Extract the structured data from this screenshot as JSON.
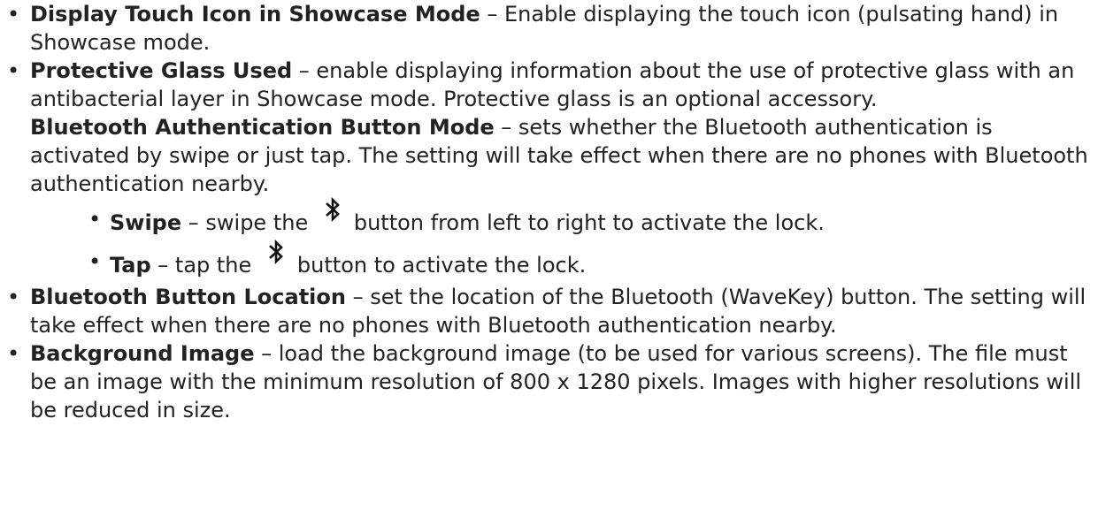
{
  "bullet_glyph": "•",
  "items": [
    {
      "term": "Display Touch Icon in Showcase Mode",
      "text": " – Enable displaying the touch icon (pulsating hand) in Showcase mode."
    },
    {
      "term": "Protective Glass Used",
      "text": " – enable displaying information about the use of protective glass with an antibacterial layer in Showcase mode. Protective glass is an optional accessory.",
      "continuation_term": "Bluetooth Authentication Button Mode",
      "continuation_text": " – sets whether the Bluetooth authentication is activated by swipe or just tap.  The setting will take effect when there are no phones with Bluetooth authentication nearby.",
      "subitems": [
        {
          "term": "Swipe",
          "before_icon": " – swipe the ",
          "icon": "bluetooth-icon",
          "after_icon": "button from left to right to activate the lock."
        },
        {
          "term": "Tap",
          "before_icon": " – tap the ",
          "icon": "bluetooth-icon",
          "after_icon": "button to activate the lock."
        }
      ]
    },
    {
      "term": "Bluetooth Button Location",
      "text": " – set the location of the Bluetooth (WaveKey) button. The setting will take effect when there are no phones with Bluetooth authentication nearby."
    },
    {
      "term": "Background Image",
      "text": " – load the background image (to be used for various screens). The file must be an image with the minimum resolution of 800 x 1280 pixels. Images with higher resolutions will be reduced in size."
    }
  ]
}
